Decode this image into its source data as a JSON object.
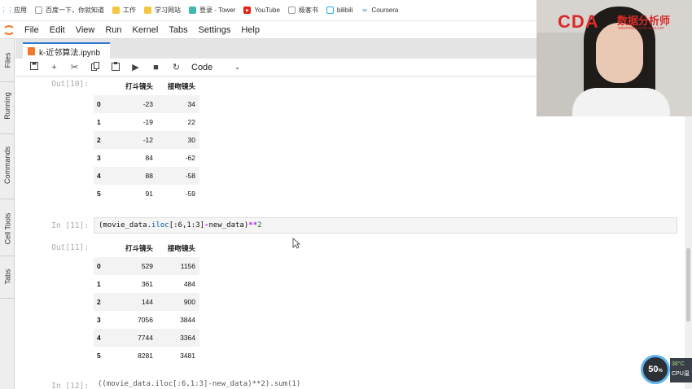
{
  "bookmarks": [
    {
      "label": "应用",
      "icon": "apps-grid-icon",
      "color": "#4285f4"
    },
    {
      "label": "百度一下，你就知道",
      "icon": "page-icon",
      "color": "#999999"
    },
    {
      "label": "工作",
      "icon": "folder-icon",
      "color": "#f4c542"
    },
    {
      "label": "学习网站",
      "icon": "folder-icon",
      "color": "#f4c542"
    },
    {
      "label": "登录 - Tower",
      "icon": "tower-icon",
      "color": "#3fb8af"
    },
    {
      "label": "YouTube",
      "icon": "youtube-icon",
      "color": "#e62117"
    },
    {
      "label": "极客书",
      "icon": "page-icon",
      "color": "#999999"
    },
    {
      "label": "bilibili",
      "icon": "bilibili-icon",
      "color": "#23ade5"
    },
    {
      "label": "Coursera",
      "icon": "coursera-icon",
      "color": "#2a73cc"
    }
  ],
  "menu": [
    "File",
    "Edit",
    "View",
    "Run",
    "Kernel",
    "Tabs",
    "Settings",
    "Help"
  ],
  "sidebar_tabs": [
    "Files",
    "Running",
    "Commands",
    "Cell Tools",
    "Tabs"
  ],
  "doc_tab": {
    "title": "k-近邻算法.ipynb"
  },
  "toolbar": {
    "cell_type": "Code"
  },
  "cells": {
    "out10": {
      "prompt": "Out[10]:",
      "columns": [
        "打斗镜头",
        "接吻镜头"
      ],
      "rows": [
        {
          "index": "0",
          "a": "-23",
          "b": "34"
        },
        {
          "index": "1",
          "a": "-19",
          "b": "22"
        },
        {
          "index": "2",
          "a": "-12",
          "b": "30"
        },
        {
          "index": "3",
          "a": "84",
          "b": "-62"
        },
        {
          "index": "4",
          "a": "88",
          "b": "-58"
        },
        {
          "index": "5",
          "a": "91",
          "b": "-59"
        }
      ]
    },
    "in11": {
      "prompt": "In [11]:",
      "code_a": "(movie_data.",
      "code_fn": "iloc",
      "code_b": "[:6,1:3]",
      "code_op1": "-",
      "code_c": "new_data)",
      "code_op2": "**",
      "code_num": "2"
    },
    "out11": {
      "prompt": "Out[11]:",
      "columns": [
        "打斗镜头",
        "接吻镜头"
      ],
      "rows": [
        {
          "index": "0",
          "a": "529",
          "b": "1156"
        },
        {
          "index": "1",
          "a": "361",
          "b": "484"
        },
        {
          "index": "2",
          "a": "144",
          "b": "900"
        },
        {
          "index": "3",
          "a": "7056",
          "b": "3844"
        },
        {
          "index": "4",
          "a": "7744",
          "b": "3364"
        },
        {
          "index": "5",
          "a": "8281",
          "b": "3481"
        }
      ]
    },
    "in12": {
      "prompt": "In [12]:",
      "code": "((movie_data.iloc[:6,1:3]-new_data)**2).sum(1)"
    }
  },
  "webcam": {
    "logo": "CDA",
    "brand": "数据分析师",
    "sub": "CERTIFIED DATA ANALYST"
  },
  "perf": {
    "percent": "50",
    "unit": "%",
    "temp": "38°C",
    "cpu_label": "CPU温"
  }
}
